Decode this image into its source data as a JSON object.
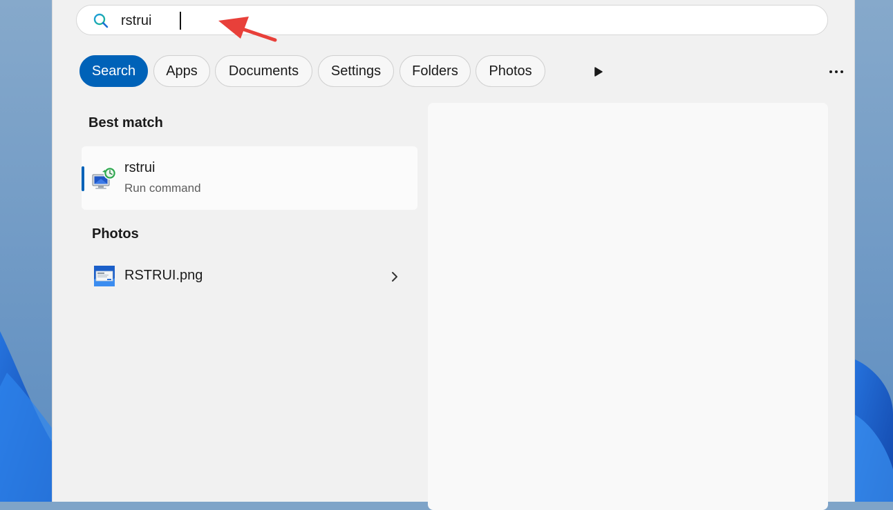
{
  "search": {
    "value": "rstrui"
  },
  "filters": {
    "chips": [
      "Search",
      "Apps",
      "Documents",
      "Settings",
      "Folders",
      "Photos"
    ],
    "active": "Search"
  },
  "best_match": {
    "heading": "Best match",
    "title": "rstrui",
    "subtitle": "Run command"
  },
  "photos": {
    "heading": "Photos",
    "items": [
      {
        "name": "RSTRUI.png"
      }
    ]
  },
  "colors": {
    "accent": "#0062b8",
    "panel_bg": "#f1f1f1",
    "annotation_arrow": "#e8403a"
  },
  "icons": {
    "search": "search-icon",
    "play": "play-icon",
    "more": "more-options-icon",
    "app": "system-restore-icon",
    "thumbnail": "image-thumbnail-icon",
    "chevron": "chevron-right-icon",
    "annotation": "annotation-arrow"
  }
}
